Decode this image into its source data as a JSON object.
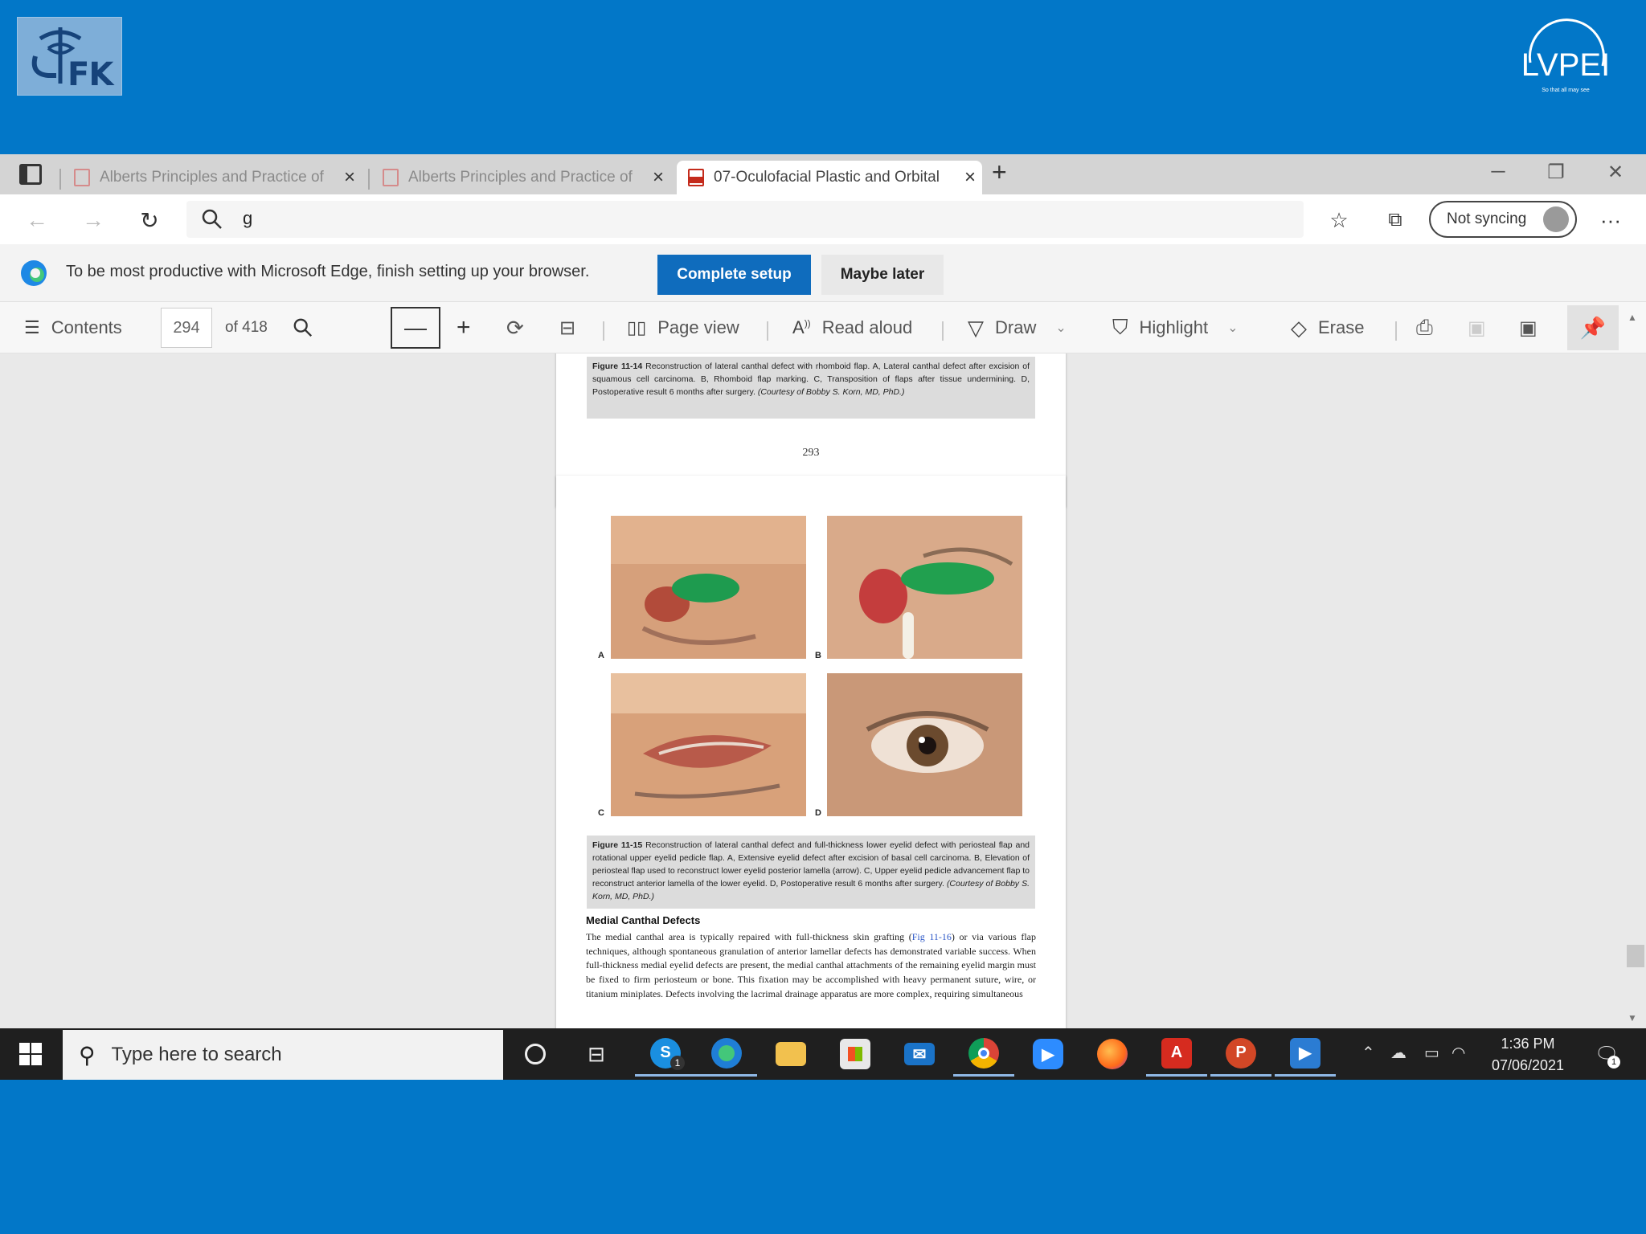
{
  "slide": {
    "logo_left_text": "FK",
    "logo_right_text": "LVPEI",
    "logo_right_tagline": "So that all may see"
  },
  "browser": {
    "tabs": [
      {
        "label": "Alberts Principles and Practice of",
        "active": false
      },
      {
        "label": "Alberts Principles and Practice of",
        "active": false
      },
      {
        "label": "07-Oculofacial Plastic and Orbital",
        "active": true
      }
    ],
    "address_query": "g",
    "sync_label": "Not syncing",
    "setup_message": "To be most productive with Microsoft Edge, finish setting up your browser.",
    "complete_setup_label": "Complete setup",
    "maybe_later_label": "Maybe later"
  },
  "pdf_toolbar": {
    "contents_label": "Contents",
    "current_page": "294",
    "page_total": "of 418",
    "page_view_label": "Page view",
    "read_aloud_label": "Read aloud",
    "draw_label": "Draw",
    "highlight_label": "Highlight",
    "erase_label": "Erase"
  },
  "document": {
    "fig14_caption_label": "Figure 11-14",
    "fig14_caption_text": "Reconstruction of lateral canthal defect with rhomboid flap. A, Lateral canthal defect after excision of squamous cell carcinoma. B, Rhomboid flap marking. C, Transposition of flaps after tissue undermining. D, Postoperative result 6 months after surgery.",
    "fig14_credit": "(Courtesy of Bobby S. Korn, MD, PhD.)",
    "page_number_293": "293",
    "panel_labels": [
      "A",
      "B",
      "C",
      "D"
    ],
    "fig15_caption_label": "Figure 11-15",
    "fig15_caption_text": "Reconstruction of lateral canthal defect and full-thickness lower eyelid defect with periosteal flap and rotational upper eyelid pedicle flap. A, Extensive eyelid defect after excision of basal cell carcinoma. B, Elevation of periosteal flap used to reconstruct lower eyelid posterior lamella (arrow). C, Upper eyelid pedicle advancement flap to reconstruct anterior lamella of the lower eyelid. D, Postoperative result 6 months after surgery.",
    "fig15_credit": "(Courtesy of Bobby S. Korn, MD, PhD.)",
    "section_heading": "Medial Canthal Defects",
    "body_before_link": "The medial canthal area is typically repaired with full-thickness skin grafting (",
    "body_link": "Fig 11-16",
    "body_after_link": ") or via various flap techniques, although spontaneous granulation of anterior lamellar defects has demonstrated variable success. When full-thickness medial eyelid defects are present, the medial canthal attachments of the remaining eyelid margin must be fixed to firm periosteum or bone. This fixation may be accomplished with heavy permanent suture, wire, or titanium miniplates. Defects involving the lacrimal drainage apparatus are more complex, requiring simultaneous"
  },
  "taskbar": {
    "search_placeholder": "Type here to search",
    "skype_badge": "1",
    "notification_badge": "1",
    "time": "1:36 PM",
    "date": "07/06/2021"
  }
}
